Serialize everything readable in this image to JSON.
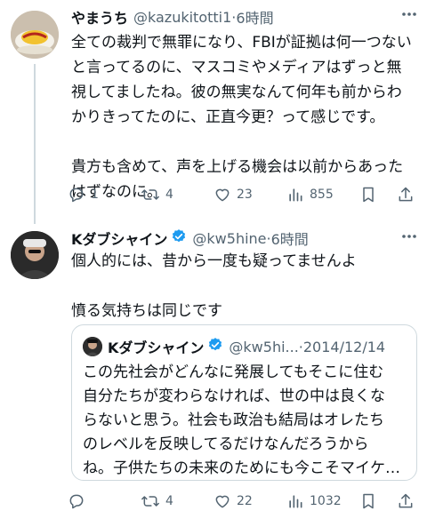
{
  "tweet1": {
    "name": "やまうち",
    "handle": "@kazukitotti1",
    "separator": "·",
    "time": "6時間",
    "text_para1": "全ての裁判で無罪になり、FBIが証拠は何一つない\nと言ってるのに、マスコミやメディアはずっと無\n視してましたね。彼の無実なんて何年も前からわ\nかりきってたのに、正直今更？って感じです。",
    "text_para2": "貴方も含めて、声を上げる機会は以前からあった\nはずなのに。",
    "replies": "1",
    "reposts": "4",
    "likes": "23",
    "views": "855"
  },
  "tweet2": {
    "name": "Kダブシャイン",
    "handle": "@kw5hine",
    "separator": "·",
    "time": "6時間",
    "text_para1": "個人的には、昔から一度も疑ってませんよ",
    "text_para2": "憤る気持ちは同じです",
    "replies": "",
    "reposts": "4",
    "likes": "22",
    "views": "1032"
  },
  "quote": {
    "name": "Kダブシャイン",
    "handle": "@kw5hi...",
    "separator": "·",
    "date": "2014/12/14",
    "text": "この先社会がどんなに発展してもそこに住む\n自分たちが変わらなければ、世の中は良くな\nらないと思う。社会も政治も結局はオレたち\nのレベルを反映してるだけなんだろうから\nね。子供たちの未来のためにも今こそマイケ…"
  },
  "colors": {
    "text": "#0f1419",
    "secondary": "#536471",
    "border": "#cfd9de",
    "verified": "#1d9bf0"
  },
  "icons": [
    "reply-icon",
    "repost-icon",
    "like-icon",
    "views-icon",
    "bookmark-icon",
    "share-icon",
    "more-icon",
    "verified-badge-icon"
  ]
}
